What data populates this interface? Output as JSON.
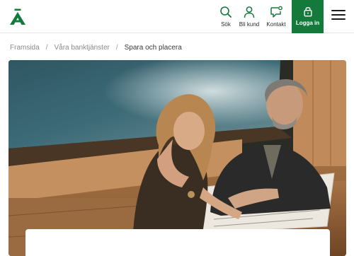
{
  "header": {
    "logo_icon": "handelsbanken-a-logo",
    "nav": {
      "search_label": "Sök",
      "become_customer_label": "Bli kund",
      "contact_label": "Kontakt",
      "login_label": "Logga in"
    },
    "icons": {
      "search": "search-icon",
      "person": "person-icon",
      "chat": "chat-bubble-icon",
      "lock": "lock-icon",
      "menu": "hamburger-menu-icon"
    },
    "brand_color": "#147a3c"
  },
  "breadcrumb": {
    "items": [
      "Framsida",
      "Våra banktjänster",
      "Spara och placera"
    ]
  },
  "hero": {
    "image_description_icon": "hero-photo"
  },
  "card": {
    "title": ""
  }
}
